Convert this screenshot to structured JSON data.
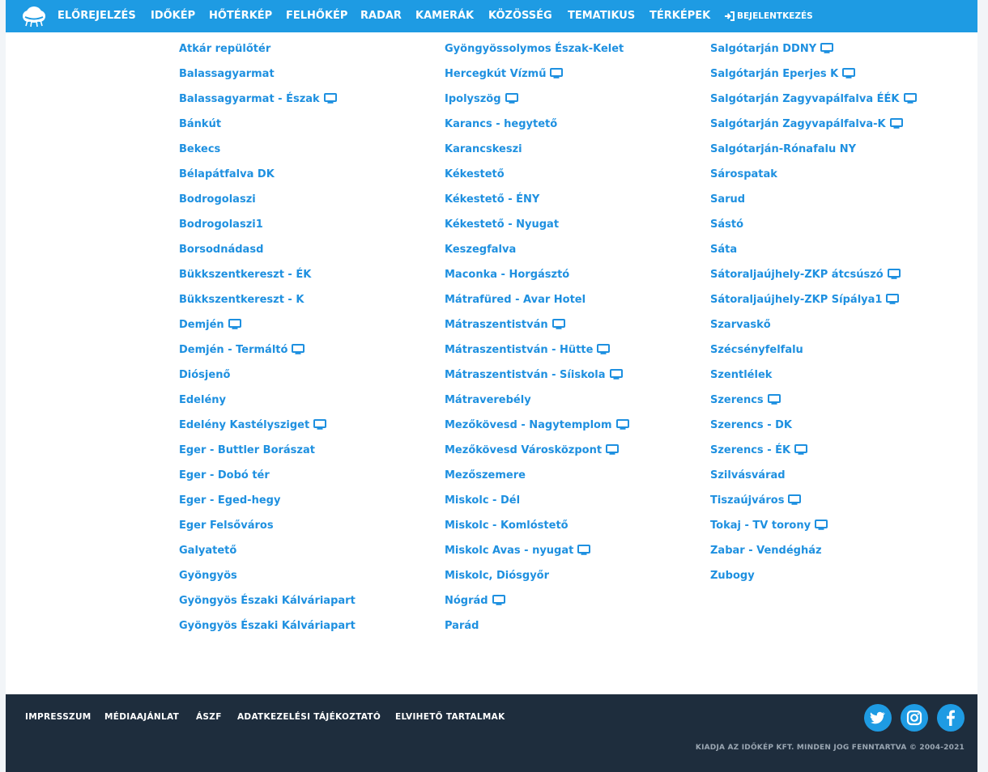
{
  "nav": {
    "items": [
      "ELŐREJELZÉS",
      "IDŐKÉP",
      "HŐTÉRKÉP",
      "FELHŐKÉP",
      "RADAR",
      "KAMERÁK",
      "KÖZÖSSÉG",
      "TEMATIKUS",
      "TÉRKÉPEK"
    ],
    "login": "BEJELENTKEZÉS"
  },
  "columns": [
    [
      {
        "name": "Atkár repülőtér",
        "camera": false
      },
      {
        "name": "Balassagyarmat",
        "camera": false
      },
      {
        "name": "Balassagyarmat - Észak",
        "camera": true
      },
      {
        "name": "Bánkút",
        "camera": false
      },
      {
        "name": "Bekecs",
        "camera": false
      },
      {
        "name": "Bélapátfalva DK",
        "camera": false
      },
      {
        "name": "Bodrogolaszi",
        "camera": false
      },
      {
        "name": "Bodrogolaszi1",
        "camera": false
      },
      {
        "name": "Borsodnádasd",
        "camera": false
      },
      {
        "name": "Bükkszentkereszt - ÉK",
        "camera": false
      },
      {
        "name": "Bükkszentkereszt - K",
        "camera": false
      },
      {
        "name": "Demjén",
        "camera": true
      },
      {
        "name": "Demjén - Termáltó",
        "camera": true
      },
      {
        "name": "Diósjenő",
        "camera": false
      },
      {
        "name": "Edelény",
        "camera": false
      },
      {
        "name": "Edelény Kastélysziget",
        "camera": true
      },
      {
        "name": "Eger - Buttler Borászat",
        "camera": false
      },
      {
        "name": "Eger - Dobó tér",
        "camera": false
      },
      {
        "name": "Eger - Eged-hegy",
        "camera": false
      },
      {
        "name": "Eger Felsőváros",
        "camera": false
      },
      {
        "name": "Galyatető",
        "camera": false
      },
      {
        "name": "Gyöngyös",
        "camera": false
      },
      {
        "name": "Gyöngyös Északi Kálváriapart",
        "camera": false
      },
      {
        "name": "Gyöngyös Északi Kálváriapart",
        "camera": false
      }
    ],
    [
      {
        "name": "Gyöngyössolymos Észak-Kelet",
        "camera": false
      },
      {
        "name": "Hercegkút Vízmű",
        "camera": true
      },
      {
        "name": "Ipolyszög",
        "camera": true
      },
      {
        "name": "Karancs - hegytető",
        "camera": false
      },
      {
        "name": "Karancskeszi",
        "camera": false
      },
      {
        "name": "Kékestető",
        "camera": false
      },
      {
        "name": "Kékestető - ÉNY",
        "camera": false
      },
      {
        "name": "Kékestető - Nyugat",
        "camera": false
      },
      {
        "name": "Keszegfalva",
        "camera": false
      },
      {
        "name": "Maconka - Horgásztó",
        "camera": false
      },
      {
        "name": "Mátrafüred - Avar Hotel",
        "camera": false
      },
      {
        "name": "Mátraszentistván",
        "camera": true
      },
      {
        "name": "Mátraszentistván - Hütte",
        "camera": true
      },
      {
        "name": "Mátraszentistván - Síiskola",
        "camera": true
      },
      {
        "name": "Mátraverebély",
        "camera": false
      },
      {
        "name": "Mezőkövesd - Nagytemplom",
        "camera": true
      },
      {
        "name": "Mezőkövesd Városközpont",
        "camera": true
      },
      {
        "name": "Mezőszemere",
        "camera": false
      },
      {
        "name": "Miskolc - Dél",
        "camera": false
      },
      {
        "name": "Miskolc - Komlóstető",
        "camera": false
      },
      {
        "name": "Miskolc Avas - nyugat",
        "camera": true
      },
      {
        "name": "Miskolc, Diósgyőr",
        "camera": false
      },
      {
        "name": "Nógrád",
        "camera": true
      },
      {
        "name": "Parád",
        "camera": false
      }
    ],
    [
      {
        "name": "Salgótarján DDNY",
        "camera": true
      },
      {
        "name": "Salgótarján Eperjes K",
        "camera": true
      },
      {
        "name": "Salgótarján Zagyvapálfalva ÉÉK",
        "camera": true
      },
      {
        "name": "Salgótarján Zagyvapálfalva-K",
        "camera": true
      },
      {
        "name": "Salgótarján-Rónafalu NY",
        "camera": false
      },
      {
        "name": "Sárospatak",
        "camera": false
      },
      {
        "name": "Sarud",
        "camera": false
      },
      {
        "name": "Sástó",
        "camera": false
      },
      {
        "name": "Sáta",
        "camera": false
      },
      {
        "name": "Sátoraljaújhely-ZKP átcsúszó",
        "camera": true
      },
      {
        "name": "Sátoraljaújhely-ZKP Sípálya1",
        "camera": true
      },
      {
        "name": "Szarvaskő",
        "camera": false
      },
      {
        "name": "Szécsényfelfalu",
        "camera": false
      },
      {
        "name": "Szentlélek",
        "camera": false
      },
      {
        "name": "Szerencs",
        "camera": true
      },
      {
        "name": "Szerencs - DK",
        "camera": false
      },
      {
        "name": "Szerencs - ÉK",
        "camera": true
      },
      {
        "name": "Szilvásvárad",
        "camera": false
      },
      {
        "name": "Tiszaújváros",
        "camera": true
      },
      {
        "name": "Tokaj - TV torony",
        "camera": true
      },
      {
        "name": "Zabar - Vendégház",
        "camera": false
      },
      {
        "name": "Zubogy",
        "camera": false
      }
    ]
  ],
  "footer": {
    "links": [
      "IMPRESSZUM",
      "MÉDIAAJÁNLAT",
      "ÁSZF",
      "ADATKEZELÉSI TÁJÉKOZTATÓ",
      "ELVIHETŐ TARTALMAK"
    ],
    "social": [
      "twitter-icon",
      "instagram-icon",
      "facebook-icon"
    ],
    "copyright": "KIADJA AZ IDŐKÉP KFT. MINDEN JOG FENNTARTVA © 2004-2021"
  },
  "colors": {
    "nav": "#1e9be3",
    "link": "#1e90e0",
    "footer": "#1e2d3d"
  },
  "icons": {
    "logo": "cloud-logo-icon",
    "camera": "monitor-icon",
    "login": "sign-in-icon"
  }
}
